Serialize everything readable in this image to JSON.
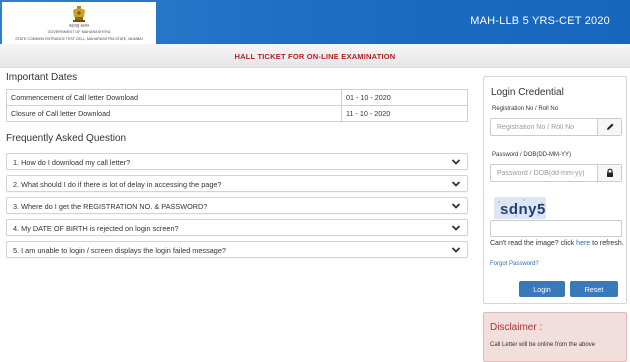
{
  "header": {
    "logo_line1": "GOVERNMENT OF MAHARASHTRA",
    "logo_line2": "STATE COMMON ENTRANCE TEST CELL, MAHARASHTRA STATE, MUMBAI",
    "logo_line3": "महाराष्ट्र शासन",
    "app_title": "MAH-LLB 5 YRS-CET 2020"
  },
  "subbar": {
    "text": "HALL TICKET FOR ON-LINE EXAMINATION"
  },
  "important_dates": {
    "title": "Important Dates",
    "rows": [
      {
        "label": "Commencement of Call letter Download",
        "date": "01 - 10 - 2020"
      },
      {
        "label": "Closure of Call letter Download",
        "date": "11 - 10 - 2020"
      }
    ]
  },
  "faq": {
    "title": "Frequently Asked Question",
    "items": [
      "1. How do I download my call letter?",
      "2. What should I do if there is lot of delay in accessing the page?",
      "3. Where do I get the REGISTRATION NO. & PASSWORD?",
      "4. My DATE OF BIRTH is rejected on login screen?",
      "5. I am unable to login / screen displays the login failed message?"
    ]
  },
  "login": {
    "title": "Login Credential",
    "reg_label": "Registration No / Roll No",
    "reg_placeholder": "Registration No / Roll No",
    "reg_value": "",
    "pwd_label": "Password / DOB(DD-MM-YY)",
    "pwd_placeholder": "Password / DOB(dd-mm-yy)",
    "pwd_value": "",
    "captcha_text": "sdny5",
    "captcha_value": "",
    "cant_read_prefix": "Can't read the image? click",
    "cant_read_link": "here",
    "cant_read_suffix": "to refresh.",
    "forgot": "Forgot Password?",
    "login_button": "Login",
    "reset_button": "Reset"
  },
  "disclaimer": {
    "title": "Disclaimer :",
    "text": "Call Letter will be online from the above"
  },
  "colors": {
    "header_blue": "#1b6cc2",
    "subbar_text": "#b22222",
    "button_blue": "#3a78b8",
    "disclaimer_bg": "#f3dede"
  },
  "icons": [
    "emblem-logo",
    "chevron-down-icon",
    "pencil-icon",
    "lock-icon"
  ]
}
